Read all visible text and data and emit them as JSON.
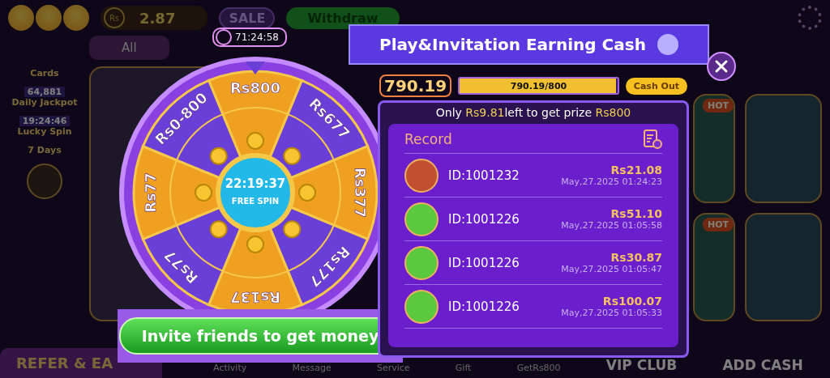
{
  "top_bar": {
    "currency": "Rs",
    "balance": "2.87",
    "sale": "SALE",
    "withdraw": "Withdraw",
    "timer": "71:24:58"
  },
  "category_tabs": [
    {
      "label": "All"
    }
  ],
  "side_menu": [
    {
      "label": "Cards"
    },
    {
      "label": "Daily Jackpot",
      "counter": "64,881"
    },
    {
      "label": "Lucky Spin",
      "counter": "19:24:46"
    },
    {
      "label": "7 Days"
    }
  ],
  "refer_banner": "REFER & EA",
  "bottom_nav": [
    "Activity",
    "Message",
    "Service",
    "Gift",
    "GetRs800",
    "VIP CLUB",
    "ADD CASH"
  ],
  "game_tiles": [
    {
      "badge": "HOT"
    },
    {
      "badge": "HOT"
    }
  ],
  "wheel": {
    "segments": [
      {
        "label": "Rs800",
        "color": "#f0a020"
      },
      {
        "label": "Rs677",
        "color": "#6a3fd8"
      },
      {
        "label": "Rs377",
        "color": "#f0a020"
      },
      {
        "label": "Rs177",
        "color": "#6a3fd8"
      },
      {
        "label": "Rs137",
        "color": "#f0a020"
      },
      {
        "label": "Rs77",
        "color": "#6a3fd8"
      },
      {
        "label": "Rs77",
        "color": "#f0a020"
      },
      {
        "label": "Rs0-800",
        "color": "#6a3fd8"
      }
    ],
    "countdown": "22:19:37",
    "spin_label": "FREE SPIN"
  },
  "invite_button": "Invite friends to get money",
  "modal": {
    "title": "Play&Invitation Earning Cash",
    "amount": "790.19",
    "progress": {
      "level": 0.988,
      "text": "790.19/800"
    },
    "cash_out": "Cash Out",
    "notice": "Only **Rs9.81**left to get prize **Rs800**"
  },
  "record": {
    "title": "Record",
    "rows": [
      {
        "id": "ID:1001232",
        "amount": "Rs21.08",
        "time": "May,27.2025 01:24:23"
      },
      {
        "id": "ID:1001226",
        "amount": "Rs51.10",
        "time": "May,27.2025 01:05:58"
      },
      {
        "id": "ID:1001226",
        "amount": "Rs30.87",
        "time": "May,27.2025 01:05:47"
      },
      {
        "id": "ID:1001226",
        "amount": "Rs100.07",
        "time": "May,27.2025 01:05:33"
      }
    ]
  }
}
